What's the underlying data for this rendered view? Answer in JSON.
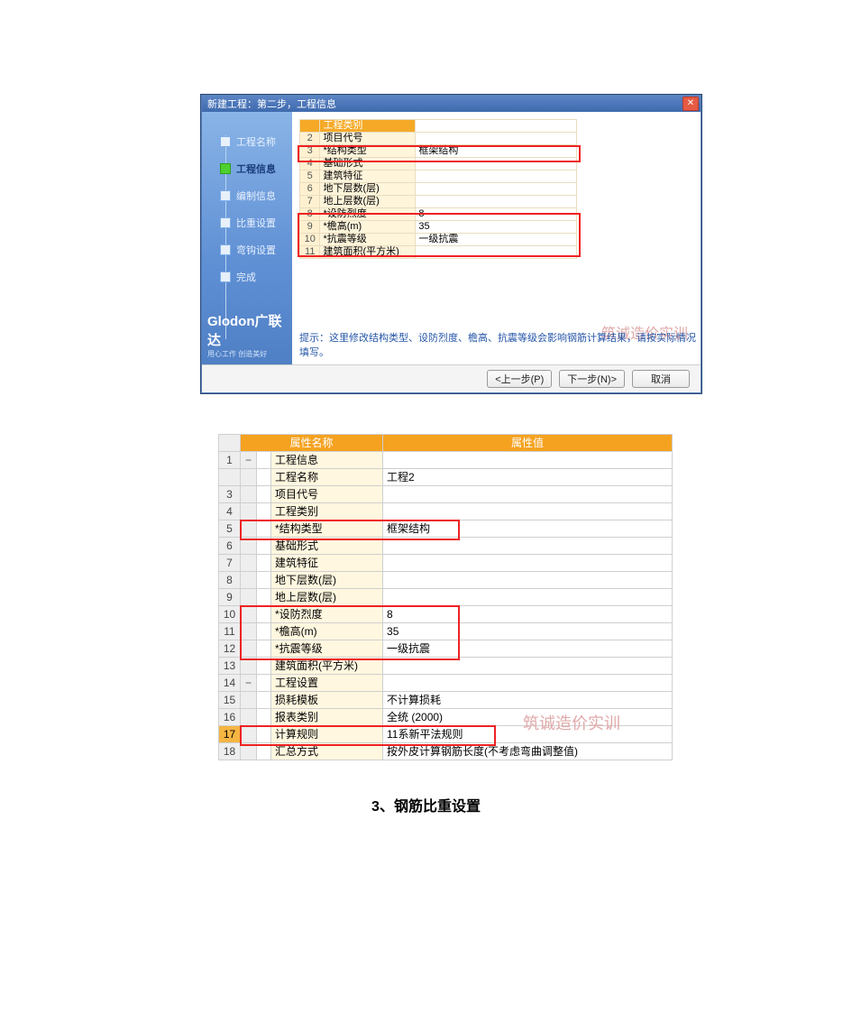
{
  "dialog": {
    "title": "新建工程：第二步，工程信息",
    "steps": [
      {
        "label": "工程名称",
        "active": false
      },
      {
        "label": "工程信息",
        "active": true
      },
      {
        "label": "编制信息",
        "active": false
      },
      {
        "label": "比重设置",
        "active": false
      },
      {
        "label": "弯钩设置",
        "active": false
      },
      {
        "label": "完成",
        "active": false
      }
    ],
    "logo": "Glodon广联达",
    "logo_sub": "用心工作 创造美好",
    "rows": [
      {
        "idx": "",
        "label": "工程类别",
        "value": ""
      },
      {
        "idx": "2",
        "label": "项目代号",
        "value": ""
      },
      {
        "idx": "3",
        "label": "*结构类型",
        "value": "框架结构"
      },
      {
        "idx": "4",
        "label": "基础形式",
        "value": ""
      },
      {
        "idx": "5",
        "label": "建筑特征",
        "value": ""
      },
      {
        "idx": "6",
        "label": "地下层数(层)",
        "value": ""
      },
      {
        "idx": "7",
        "label": "地上层数(层)",
        "value": ""
      },
      {
        "idx": "8",
        "label": "*设防烈度",
        "value": "8"
      },
      {
        "idx": "9",
        "label": "*檐高(m)",
        "value": "35"
      },
      {
        "idx": "10",
        "label": "*抗震等级",
        "value": "一级抗震"
      },
      {
        "idx": "11",
        "label": "建筑面积(平方米)",
        "value": ""
      }
    ],
    "hint": "提示：这里修改结构类型、设防烈度、檐高、抗震等级会影响钢筋计算结果，请按实际情况填写。",
    "watermark": "筑诚造价实训",
    "buttons": {
      "prev": "<上一步(P)",
      "next": "下一步(N)>",
      "cancel": "取消"
    }
  },
  "propTable": {
    "header_name": "属性名称",
    "header_val": "属性值",
    "rows": [
      {
        "n": "1",
        "toggle": "−",
        "mark": "",
        "name": "工程信息",
        "value": ""
      },
      {
        "n": "",
        "toggle": "",
        "mark": "",
        "name": "工程名称",
        "value": "工程2"
      },
      {
        "n": "3",
        "toggle": "",
        "mark": "",
        "name": "项目代号",
        "value": ""
      },
      {
        "n": "4",
        "toggle": "",
        "mark": "",
        "name": "工程类别",
        "value": ""
      },
      {
        "n": "5",
        "toggle": "",
        "mark": "",
        "name": "*结构类型",
        "value": "框架结构"
      },
      {
        "n": "6",
        "toggle": "",
        "mark": "",
        "name": "基础形式",
        "value": ""
      },
      {
        "n": "7",
        "toggle": "",
        "mark": "",
        "name": "建筑特征",
        "value": ""
      },
      {
        "n": "8",
        "toggle": "",
        "mark": "",
        "name": "地下层数(层)",
        "value": ""
      },
      {
        "n": "9",
        "toggle": "",
        "mark": "",
        "name": "地上层数(层)",
        "value": ""
      },
      {
        "n": "10",
        "toggle": "",
        "mark": "",
        "name": "*设防烈度",
        "value": "8"
      },
      {
        "n": "11",
        "toggle": "",
        "mark": "",
        "name": "*檐高(m)",
        "value": "35"
      },
      {
        "n": "12",
        "toggle": "",
        "mark": "",
        "name": "*抗震等级",
        "value": "一级抗震"
      },
      {
        "n": "13",
        "toggle": "",
        "mark": "",
        "name": "建筑面积(平方米)",
        "value": ""
      },
      {
        "n": "14",
        "toggle": "−",
        "mark": "",
        "name": "工程设置",
        "value": ""
      },
      {
        "n": "15",
        "toggle": "",
        "mark": "",
        "name": "损耗模板",
        "value": "不计算损耗"
      },
      {
        "n": "16",
        "toggle": "",
        "mark": "",
        "name": "报表类别",
        "value": "全统 (2000)"
      },
      {
        "n": "17",
        "toggle": "",
        "mark": "",
        "name": "计算规则",
        "value": "11系新平法规则"
      },
      {
        "n": "18",
        "toggle": "",
        "mark": "",
        "name": "汇总方式",
        "value": "按外皮计算钢筋长度(不考虑弯曲调整值)"
      }
    ],
    "selected_row": 17,
    "watermark": "筑诚造价实训"
  },
  "heading": "3、钢筋比重设置"
}
